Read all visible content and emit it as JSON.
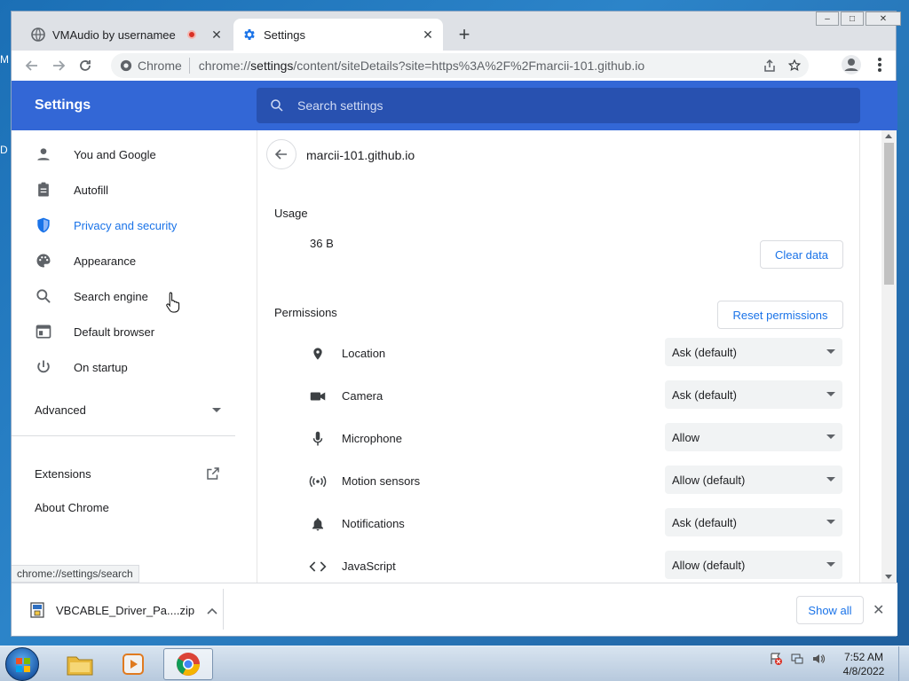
{
  "desktop": {
    "left_fragments": [
      "M",
      "D"
    ]
  },
  "tabs": [
    {
      "title": "VMAudio by usernamee",
      "active": false,
      "recording": true
    },
    {
      "title": "Settings",
      "active": true,
      "recording": false
    }
  ],
  "window_controls": [
    "minimize",
    "maximize",
    "close"
  ],
  "omnibox": {
    "chip_label": "Chrome",
    "url_prefix": "chrome://",
    "url_host": "settings",
    "url_rest": "/content/siteDetails?site=https%3A%2F%2Fmarcii-101.github.io"
  },
  "settings": {
    "title": "Settings",
    "search_placeholder": "Search settings"
  },
  "sidebar": {
    "items": [
      {
        "label": "You and Google",
        "icon": "person-icon"
      },
      {
        "label": "Autofill",
        "icon": "clipboard-icon"
      },
      {
        "label": "Privacy and security",
        "icon": "shield-icon",
        "selected": true
      },
      {
        "label": "Appearance",
        "icon": "palette-icon"
      },
      {
        "label": "Search engine",
        "icon": "search-icon"
      },
      {
        "label": "Default browser",
        "icon": "browser-icon"
      },
      {
        "label": "On startup",
        "icon": "power-icon"
      }
    ],
    "advanced_label": "Advanced",
    "extensions_label": "Extensions",
    "about_label": "About Chrome"
  },
  "site_details": {
    "site": "marcii-101.github.io",
    "usage_label": "Usage",
    "usage_value": "36 B",
    "clear_data_label": "Clear data",
    "permissions_label": "Permissions",
    "reset_permissions_label": "Reset permissions",
    "permissions": [
      {
        "name": "Location",
        "value": "Ask (default)",
        "icon": "location-icon"
      },
      {
        "name": "Camera",
        "value": "Ask (default)",
        "icon": "camera-icon"
      },
      {
        "name": "Microphone",
        "value": "Allow",
        "icon": "microphone-icon"
      },
      {
        "name": "Motion sensors",
        "value": "Allow (default)",
        "icon": "motion-sensors-icon"
      },
      {
        "name": "Notifications",
        "value": "Ask (default)",
        "icon": "bell-icon"
      },
      {
        "name": "JavaScript",
        "value": "Allow (default)",
        "icon": "code-icon"
      }
    ]
  },
  "status_bar": {
    "text": "chrome://settings/search"
  },
  "downloads": {
    "file_name": "VBCABLE_Driver_Pa....zip",
    "show_all_label": "Show all"
  },
  "taskbar": {
    "apps": [
      "explorer",
      "media-player",
      "chrome"
    ],
    "time": "7:52 AM",
    "date": "4/8/2022"
  },
  "colors": {
    "accent": "#1a73e8",
    "header": "#3367d6",
    "search_box": "#2851b0"
  }
}
